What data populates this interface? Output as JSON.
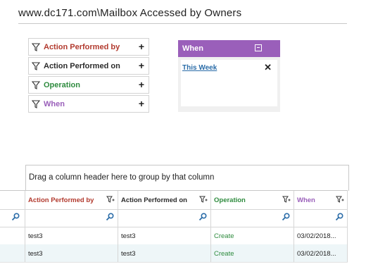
{
  "page": {
    "title": "www.dc171.com\\Mailbox Accessed by Owners"
  },
  "colors": {
    "red": "#b23a2e",
    "dark": "#2b2b2b",
    "green": "#2e8b3e",
    "purple": "#9a5fba",
    "link": "#2a6ca8"
  },
  "filters": [
    {
      "label": "Action Performed by",
      "color": "#b23a2e",
      "icon": "filter-icon"
    },
    {
      "label": "Action Performed on",
      "color": "#2b2b2b",
      "icon": "filter-icon"
    },
    {
      "label": "Operation",
      "color": "#2e8b3e",
      "icon": "filter-icon"
    },
    {
      "label": "When",
      "color": "#9a5fba",
      "icon": "filter-icon"
    }
  ],
  "when_panel": {
    "title": "When",
    "link": "This Week"
  },
  "grid": {
    "group_hint": "Drag a column header here to group by that column",
    "columns": [
      {
        "label": "Action Performed by",
        "color": "#b23a2e"
      },
      {
        "label": "Action Performed on",
        "color": "#2b2b2b"
      },
      {
        "label": "Operation",
        "color": "#2e8b3e"
      },
      {
        "label": "When",
        "color": "#9a5fba"
      }
    ],
    "rows": [
      [
        "test3",
        "test3",
        "Create",
        "03/02/2018..."
      ],
      [
        "test3",
        "test3",
        "Create",
        "03/02/2018..."
      ]
    ]
  }
}
